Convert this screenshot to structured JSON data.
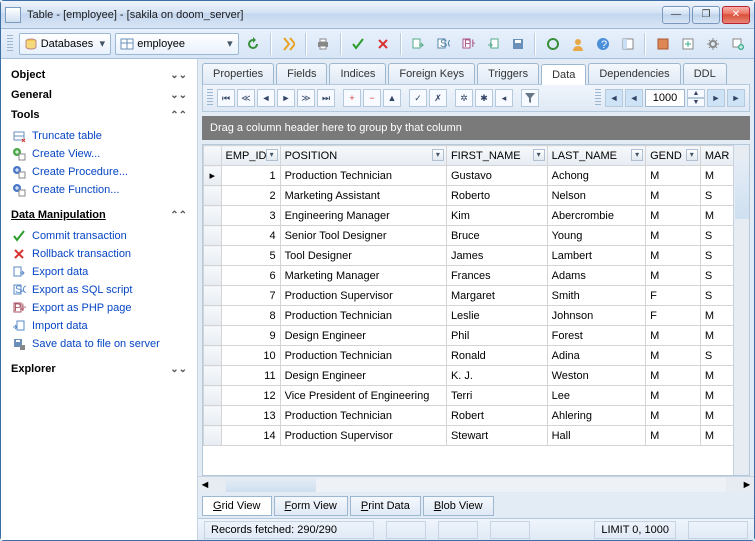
{
  "window": {
    "title": "Table - [employee] - [sakila on doom_server]"
  },
  "window_buttons": {
    "minimize": "—",
    "maximize": "❐",
    "close": "✕"
  },
  "toolbar": {
    "databases_label": "Databases",
    "object_label": "employee"
  },
  "sidebar": {
    "object_label": "Object",
    "general_label": "General",
    "tools_label": "Tools",
    "tools": [
      {
        "label": "Truncate table",
        "icon": "truncate-icon"
      },
      {
        "label": "Create View...",
        "icon": "plus-green-icon"
      },
      {
        "label": "Create Procedure...",
        "icon": "plus-blue-icon"
      },
      {
        "label": "Create Function...",
        "icon": "plus-blue-icon"
      }
    ],
    "manip_label": "Data Manipulation",
    "manip": [
      {
        "label": "Commit transaction",
        "icon": "check-green-icon"
      },
      {
        "label": "Rollback transaction",
        "icon": "x-red-icon"
      },
      {
        "label": "Export data",
        "icon": "export-icon"
      },
      {
        "label": "Export as SQL script",
        "icon": "export-sql-icon"
      },
      {
        "label": "Export as PHP page",
        "icon": "export-php-icon"
      },
      {
        "label": "Import data",
        "icon": "import-icon"
      },
      {
        "label": "Save data to file on server",
        "icon": "save-server-icon"
      }
    ],
    "explorer_label": "Explorer"
  },
  "tabs": [
    "Properties",
    "Fields",
    "Indices",
    "Foreign Keys",
    "Triggers",
    "Data",
    "Dependencies",
    "DDL"
  ],
  "active_tab": "Data",
  "pager": {
    "value": "1000"
  },
  "group_hint": "Drag a column header here to group by that column",
  "columns": [
    "EMP_ID",
    "POSITION",
    "FIRST_NAME",
    "LAST_NAME",
    "GEND",
    "MAR"
  ],
  "rows": [
    {
      "id": 1,
      "pos": "Production Technician",
      "fn": "Gustavo",
      "ln": "Achong",
      "g": "M",
      "m": "M"
    },
    {
      "id": 2,
      "pos": "Marketing Assistant",
      "fn": "Roberto",
      "ln": "Nelson",
      "g": "M",
      "m": "S"
    },
    {
      "id": 3,
      "pos": "Engineering Manager",
      "fn": "Kim",
      "ln": "Abercrombie",
      "g": "M",
      "m": "M"
    },
    {
      "id": 4,
      "pos": "Senior Tool Designer",
      "fn": "Bruce",
      "ln": "Young",
      "g": "M",
      "m": "S"
    },
    {
      "id": 5,
      "pos": "Tool Designer",
      "fn": "James",
      "ln": "Lambert",
      "g": "M",
      "m": "S"
    },
    {
      "id": 6,
      "pos": "Marketing Manager",
      "fn": "Frances",
      "ln": "Adams",
      "g": "M",
      "m": "S"
    },
    {
      "id": 7,
      "pos": "Production Supervisor",
      "fn": "Margaret",
      "ln": "Smith",
      "g": "F",
      "m": "S"
    },
    {
      "id": 8,
      "pos": "Production Technician",
      "fn": "Leslie",
      "ln": "Johnson",
      "g": "F",
      "m": "M"
    },
    {
      "id": 9,
      "pos": "Design Engineer",
      "fn": "Phil",
      "ln": "Forest",
      "g": "M",
      "m": "M"
    },
    {
      "id": 10,
      "pos": "Production Technician",
      "fn": "Ronald",
      "ln": "Adina",
      "g": "M",
      "m": "S"
    },
    {
      "id": 11,
      "pos": "Design Engineer",
      "fn": "K. J.",
      "ln": "Weston",
      "g": "M",
      "m": "M"
    },
    {
      "id": 12,
      "pos": "Vice President of Engineering",
      "fn": "Terri",
      "ln": "Lee",
      "g": "M",
      "m": "M"
    },
    {
      "id": 13,
      "pos": "Production Technician",
      "fn": "Robert",
      "ln": "Ahlering",
      "g": "M",
      "m": "M"
    },
    {
      "id": 14,
      "pos": "Production Supervisor",
      "fn": "Stewart",
      "ln": "Hall",
      "g": "M",
      "m": "M"
    }
  ],
  "view_tabs": [
    "Grid View",
    "Form View",
    "Print Data",
    "Blob View"
  ],
  "active_view_tab": "Grid View",
  "status": {
    "records": "Records fetched: 290/290",
    "limit": "LIMIT 0, 1000"
  }
}
